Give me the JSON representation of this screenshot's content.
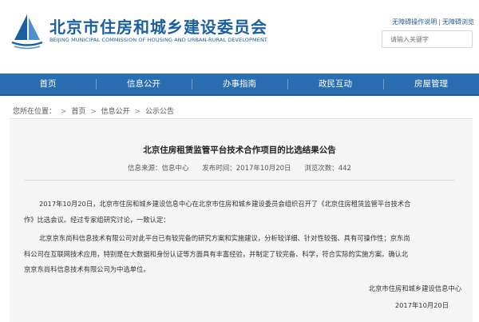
{
  "header": {
    "title": "北京市住房和城乡建设委员会",
    "subtitle": "BEIJING MUNICIPAL COMMISSION OF HOUSING AND URBAN-RURAL DEVELOPMENT",
    "access_links": [
      "无障碍操作说明",
      "无障碍浏览"
    ],
    "search_placeholder": "请输入关键字"
  },
  "nav": {
    "items": [
      "首页",
      "信息公开",
      "办事指南",
      "政民互动",
      "房屋管理"
    ]
  },
  "breadcrumb": {
    "prefix": "您所在位置：",
    "items": [
      "首页",
      "信息公开",
      "公示公告"
    ]
  },
  "article": {
    "title": "北京住房租赁监管平台技术合作项目的比选结果公告",
    "source": "信息来源：信息中心",
    "published": "发布时间：2017年10月20日",
    "views": "浏览次数：442",
    "paragraphs": {
      "p1_line1": "2017年10月20日，北京市住房和城乡建设信息中心在北京市住房和城乡建设委员会组织召开了《北京住房租赁监管平台技术合",
      "p1_line2": "作》比选会议。经过专家组研究讨论，一致认定：",
      "p2_line1": "北京京东尚科信息技术有限公司对此平台已有较完备的研究方案和实施建议，分析较详细、针对性较强、具有可操作性；京东尚",
      "p2_line2": "科公司在互联网技术应用，特别是在大数据和身份认证等方面具有丰富经验，并制定了较完备、科学，符合实际的实施方案。确认北",
      "p2_line3": "京京东尚科信息技术有限公司为中选单位。"
    },
    "signature_org": "北京市住房和城乡建设信息中心",
    "signature_date": "2017年10月20日"
  },
  "colors": {
    "brand_blue": "#1a5fa0",
    "nav_blue": "#2a6db0",
    "panel_bg": "#f5f5f5"
  },
  "icons": {
    "logo": "sail-logo-icon"
  }
}
